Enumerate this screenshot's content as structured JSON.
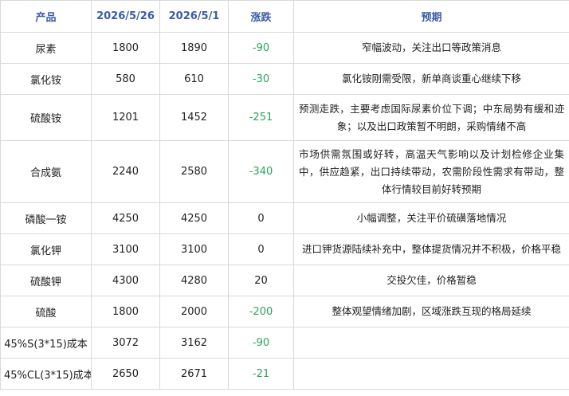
{
  "table": {
    "headers": {
      "product": "产品",
      "date1": "2026/5/26",
      "date2": "2026/5/1",
      "change": "涨跌",
      "outlook": "预期"
    },
    "rows": [
      {
        "product": "尿素",
        "date1": "1800",
        "date2": "1890",
        "change": "-90",
        "outlook": "窄幅波动，关注出口等政策消息"
      },
      {
        "product": "氯化铵",
        "date1": "580",
        "date2": "610",
        "change": "-30",
        "outlook": "氯化铵刚需受限，新单商谈重心继续下移"
      },
      {
        "product": "硫酸铵",
        "date1": "1201",
        "date2": "1452",
        "change": "-251",
        "outlook": "预测走跌，主要考虑国际尿素价位下调；中东局势有缓和迹象；以及出口政策暂不明朗，采购情绪不高"
      },
      {
        "product": "合成氨",
        "date1": "2240",
        "date2": "2580",
        "change": "-340",
        "outlook": "市场供需氛围或好转，高温天气影响以及计划检修企业集中，供应趋紧，出口持续带动，农需阶段性需求有带动，整体行情较目前好转预期"
      },
      {
        "product": "磷酸一铵",
        "date1": "4250",
        "date2": "4250",
        "change": "0",
        "outlook": "小幅调整，关注平价硫磺落地情况"
      },
      {
        "product": "氯化钾",
        "date1": "3100",
        "date2": "3100",
        "change": "0",
        "outlook": "进口钾货源陆续补充中，整体提货情况并不积极，价格平稳"
      },
      {
        "product": "硫酸钾",
        "date1": "4300",
        "date2": "4280",
        "change": "20",
        "outlook": "交投欠佳，价格暂稳"
      },
      {
        "product": "硫酸",
        "date1": "1800",
        "date2": "2000",
        "change": "-200",
        "outlook": "整体观望情绪加剧，区域涨跌互现的格局延续"
      },
      {
        "product": "45%S(3*15)成本",
        "date1": "3072",
        "date2": "3162",
        "change": "-90",
        "outlook": ""
      },
      {
        "product": "45%CL(3*15)成本",
        "date1": "2650",
        "date2": "2671",
        "change": "-21",
        "outlook": ""
      }
    ]
  },
  "colors": {
    "header_text": "#3a5ba6",
    "negative_change": "#2aa55a",
    "border": "#d9d9d9"
  }
}
